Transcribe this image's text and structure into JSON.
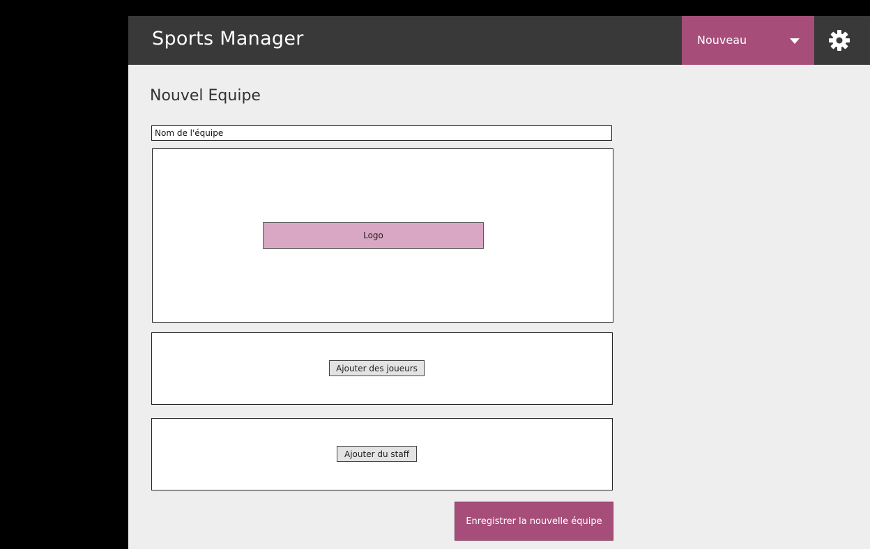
{
  "header": {
    "app_title": "Sports Manager",
    "dropdown_label": "Nouveau",
    "settings_icon": "gear-icon"
  },
  "main": {
    "page_title": "Nouvel Equipe",
    "team_name_placeholder": "Nom de l'équipe",
    "logo_button_label": "Logo",
    "add_players_label": "Ajouter des joueurs",
    "add_staff_label": "Ajouter du staff",
    "save_button_label": "Enregistrer la nouvelle équipe"
  },
  "colors": {
    "background": "#000000",
    "app_background": "#eeeeee",
    "topbar": "#393939",
    "accent": "#a64e79",
    "logo_button": "#d9a6c3"
  }
}
